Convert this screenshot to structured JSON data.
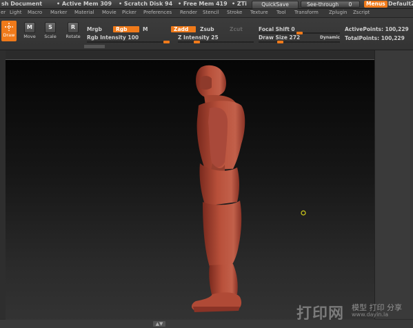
{
  "titlebar": {
    "doc": "sh Document",
    "active_mem": "• Active Mem 309",
    "scratch": "• Scratch Disk 94",
    "free_mem": "• Free Mem 419",
    "ztime": "• ZTi",
    "quicksave": "QuickSave",
    "see_through": "See-through",
    "see_through_val": "0",
    "menus": "Menus",
    "default": "DefaultZ"
  },
  "menubar": {
    "items": [
      "er",
      "Light",
      "Macro",
      "Marker",
      "Material",
      "Movie",
      "Picker",
      "Preferences",
      "Render",
      "Stencil",
      "Stroke",
      "Texture",
      "Tool",
      "Transform",
      "Zplugin",
      "Zscript"
    ]
  },
  "tools": {
    "draw": "Draw",
    "move": "Move",
    "scale": "Scale",
    "rotate": "Rotate",
    "move_glyph": "M",
    "scale_glyph": "S",
    "rotate_glyph": "R"
  },
  "options": {
    "mrgb": "Mrgb",
    "rgb": "Rgb",
    "m": "M",
    "zadd": "Zadd",
    "zsub": "Zsub",
    "zcut": "Zcut",
    "rgb_intensity": "Rgb  Intensity 100",
    "z_intensity": "Z  Intensity 25",
    "focal_shift": "Focal  Shift 0",
    "draw_size": "Draw  Size 272",
    "dynamic": "Dynamic",
    "active_points": "ActivePoints: 100,229",
    "total_points": "TotalPoints: 100,229"
  },
  "sliders": {
    "rgb_intensity": 1.0,
    "z_intensity": 0.25,
    "focal_shift": 0.5,
    "draw_size": 0.27
  },
  "watermark": {
    "cn": "打印网",
    "sub": "模型 打印 分享",
    "url": "www.dayin.la"
  },
  "colors": {
    "accent": "#f07a1a",
    "model": "#b04a36"
  },
  "scroll_glyph": "▲▼"
}
